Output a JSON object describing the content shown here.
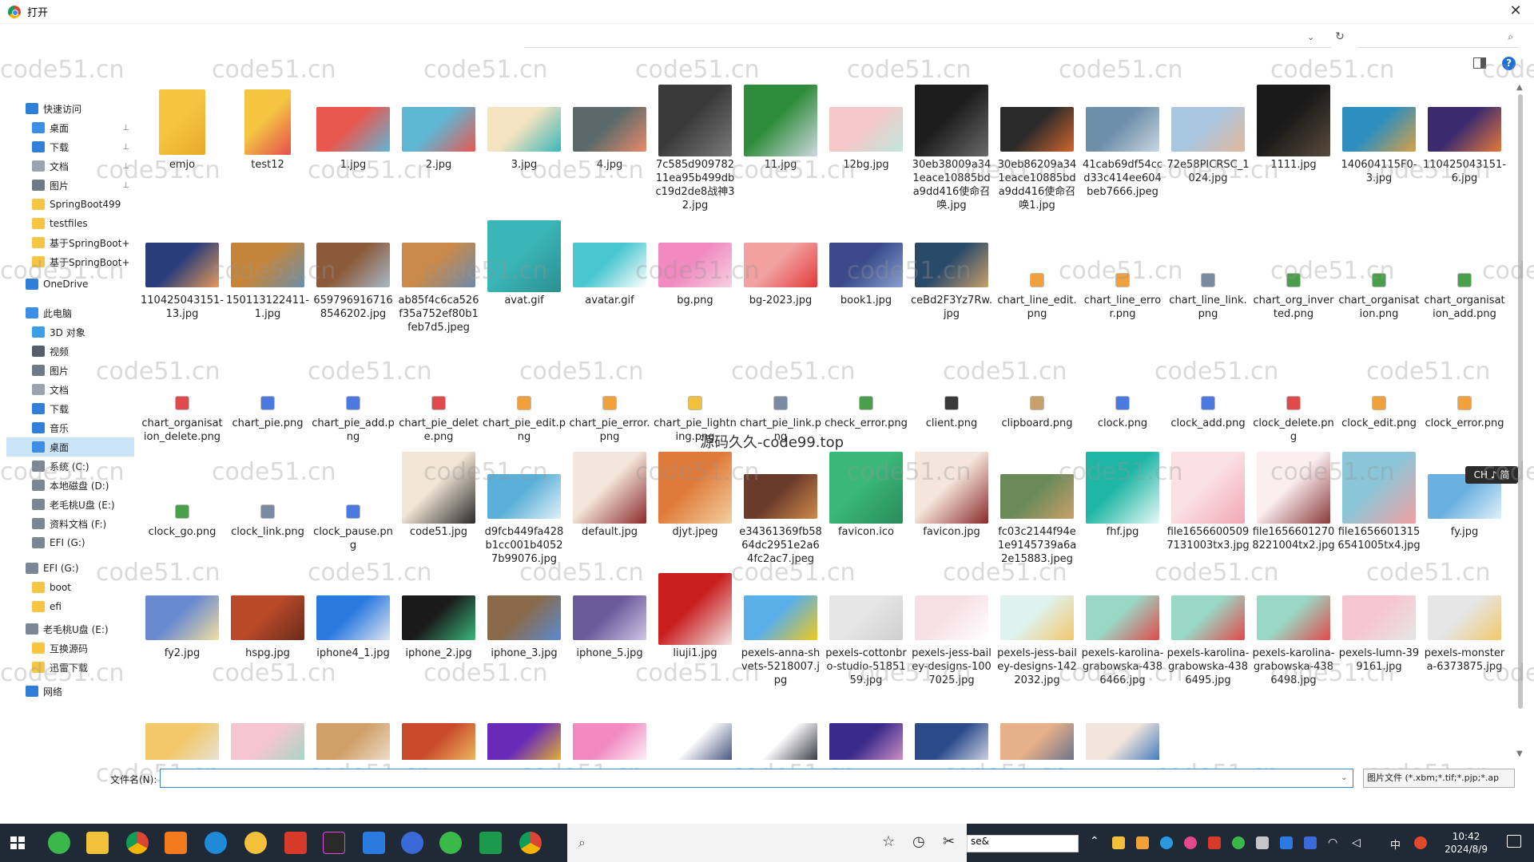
{
  "window": {
    "title": "打开"
  },
  "search": {
    "placeholder": ""
  },
  "sidebar": {
    "items": [
      {
        "label": "快速访问",
        "icon": "star-icon",
        "color": "#2f7fd8",
        "pin": false
      },
      {
        "label": "桌面",
        "icon": "desktop-icon",
        "color": "#3a8ee6",
        "pin": true
      },
      {
        "label": "下载",
        "icon": "download-icon",
        "color": "#2f7fd8",
        "pin": true
      },
      {
        "label": "文档",
        "icon": "document-icon",
        "color": "#9aa4b0",
        "pin": true
      },
      {
        "label": "图片",
        "icon": "pictures-icon",
        "color": "#6c7a89",
        "pin": true
      },
      {
        "label": "SpringBoot499",
        "icon": "folder-icon",
        "color": "#f5c542",
        "pin": false
      },
      {
        "label": "testfiles",
        "icon": "folder-icon",
        "color": "#f5c542",
        "pin": false
      },
      {
        "label": "基于SpringBoot+",
        "icon": "folder-icon",
        "color": "#f5c542",
        "pin": false
      },
      {
        "label": "基于SpringBoot+",
        "icon": "folder-icon",
        "color": "#f5c542",
        "pin": false
      },
      {
        "label": "OneDrive",
        "icon": "cloud-icon",
        "color": "#2f7fd8",
        "pin": false
      },
      {
        "label": "此电脑",
        "icon": "computer-icon",
        "color": "#3a8ee6",
        "pin": false
      },
      {
        "label": "3D 对象",
        "icon": "cube-icon",
        "color": "#3aa0e6",
        "pin": false
      },
      {
        "label": "视频",
        "icon": "video-icon",
        "color": "#555e6a",
        "pin": false
      },
      {
        "label": "图片",
        "icon": "pictures-icon",
        "color": "#6c7a89",
        "pin": false
      },
      {
        "label": "文档",
        "icon": "document-icon",
        "color": "#9aa4b0",
        "pin": false
      },
      {
        "label": "下载",
        "icon": "download-icon",
        "color": "#2f7fd8",
        "pin": false
      },
      {
        "label": "音乐",
        "icon": "music-icon",
        "color": "#2f7fd8",
        "pin": false
      },
      {
        "label": "桌面",
        "icon": "desktop-icon",
        "color": "#3a8ee6",
        "pin": false,
        "selected": true
      },
      {
        "label": "系统 (C:)",
        "icon": "drive-icon",
        "color": "#7a8796",
        "pin": false
      },
      {
        "label": "本地磁盘 (D:)",
        "icon": "drive-icon",
        "color": "#7a8796",
        "pin": false
      },
      {
        "label": "老毛桃U盘 (E:)",
        "icon": "drive-icon",
        "color": "#7a8796",
        "pin": false
      },
      {
        "label": "资料文档 (F:)",
        "icon": "drive-icon",
        "color": "#7a8796",
        "pin": false
      },
      {
        "label": "EFI (G:)",
        "icon": "drive-icon",
        "color": "#7a8796",
        "pin": false
      },
      {
        "label": "EFI (G:)",
        "icon": "drive-icon",
        "color": "#7a8796",
        "pin": false
      },
      {
        "label": "boot",
        "icon": "folder-icon",
        "color": "#f5c542",
        "pin": false
      },
      {
        "label": "efi",
        "icon": "folder-icon",
        "color": "#f5c542",
        "pin": false
      },
      {
        "label": "老毛桃U盘 (E:)",
        "icon": "drive-icon",
        "color": "#7a8796",
        "pin": false
      },
      {
        "label": "互换源码",
        "icon": "folder-icon",
        "color": "#f5c542",
        "pin": false
      },
      {
        "label": "迅雷下载",
        "icon": "folder-icon",
        "color": "#f5c542",
        "pin": false
      },
      {
        "label": "网络",
        "icon": "network-icon",
        "color": "#2f7fd8",
        "pin": false
      }
    ]
  },
  "files": [
    {
      "name": "emjo",
      "kind": "folder",
      "colors": [
        "#f5c542",
        "#e9a82a"
      ]
    },
    {
      "name": "test12",
      "kind": "folder",
      "colors": [
        "#f5c542",
        "#e44d4d"
      ]
    },
    {
      "name": "1.jpg",
      "kind": "image",
      "colors": [
        "#e8584f",
        "#5fb7d6"
      ]
    },
    {
      "name": "2.jpg",
      "kind": "image",
      "colors": [
        "#5fb7d6",
        "#e8584f"
      ]
    },
    {
      "name": "3.jpg",
      "kind": "image",
      "colors": [
        "#f3e3c0",
        "#3bb6b8"
      ]
    },
    {
      "name": "4.jpg",
      "kind": "image",
      "colors": [
        "#5a6a6a",
        "#e88a6a"
      ]
    },
    {
      "name": "7c585d90978211eа95b499dbc19d2de8战神32.jpg",
      "kind": "image",
      "colors": [
        "#3a3a3a",
        "#7a7a7a"
      ]
    },
    {
      "name": "11.jpg",
      "kind": "image",
      "colors": [
        "#2e8b3a",
        "#cfd9e0"
      ]
    },
    {
      "name": "12bg.jpg",
      "kind": "image",
      "colors": [
        "#f6c7c7",
        "#bfe6dd"
      ]
    },
    {
      "name": "30eb38009a341eace10885bda9dd416使命召唤.jpg",
      "kind": "image",
      "colors": [
        "#1d1d1d",
        "#6a6a6a"
      ]
    },
    {
      "name": "30eb86209a341eace10885bda9dd416使命召唤1.jpg",
      "kind": "image",
      "colors": [
        "#2a2a2a",
        "#d2652d"
      ]
    },
    {
      "name": "41cab69df54ccd33c414ee604beb7666.jpeg",
      "kind": "image",
      "colors": [
        "#6e8faa",
        "#c8d6e0"
      ]
    },
    {
      "name": "72e58PICRSC_1024.jpg",
      "kind": "image",
      "colors": [
        "#a9c6e0",
        "#e3b89a"
      ]
    },
    {
      "name": "1111.jpg",
      "kind": "image",
      "colors": [
        "#1a1a1a",
        "#5a4a3a"
      ]
    },
    {
      "name": "140604115F0-3.jpg",
      "kind": "image",
      "colors": [
        "#2d8fbf",
        "#d9a043"
      ]
    },
    {
      "name": "110425043151-6.jpg",
      "kind": "image",
      "colors": [
        "#3c2a6e",
        "#e57a3a"
      ]
    },
    {
      "name": "110425043151-13.jpg",
      "kind": "image",
      "colors": [
        "#2a3c7a",
        "#e59a5a"
      ]
    },
    {
      "name": "150113122411-1.jpg",
      "kind": "image",
      "colors": [
        "#c4853a",
        "#6a8faa"
      ]
    },
    {
      "name": "6597969167168546202.jpg",
      "kind": "image",
      "colors": [
        "#8a5a3a",
        "#a9b8c6"
      ]
    },
    {
      "name": "ab85f4c6ca526f35a752ef80b1feb7d5.jpeg",
      "kind": "image",
      "colors": [
        "#c98a4a",
        "#6e8aa9"
      ]
    },
    {
      "name": "avat.gif",
      "kind": "image",
      "colors": [
        "#3bb6b8",
        "#2b8f91"
      ]
    },
    {
      "name": "avatar.gif",
      "kind": "image",
      "colors": [
        "#49c7d0",
        "#ffffff"
      ]
    },
    {
      "name": "bg.png",
      "kind": "image",
      "colors": [
        "#f08ac0",
        "#f5d0e0"
      ]
    },
    {
      "name": "bg-2023.jpg",
      "kind": "image",
      "colors": [
        "#f2a0a0",
        "#e23a3a"
      ]
    },
    {
      "name": "book1.jpg",
      "kind": "image",
      "colors": [
        "#3a4a8a",
        "#8aa0d0"
      ]
    },
    {
      "name": "ceBd2F3Yz7Rw.jpg",
      "kind": "image",
      "colors": [
        "#2a4a6a",
        "#c9a06a"
      ]
    },
    {
      "name": "chart_line_edit.png",
      "kind": "icon",
      "colors": [
        "#f2a03a"
      ]
    },
    {
      "name": "chart_line_error.png",
      "kind": "icon",
      "colors": [
        "#f2a03a"
      ]
    },
    {
      "name": "chart_line_link.png",
      "kind": "icon",
      "colors": [
        "#7a8aa0"
      ]
    },
    {
      "name": "chart_org_inverted.png",
      "kind": "icon",
      "colors": [
        "#4aa04a"
      ]
    },
    {
      "name": "chart_organisation.png",
      "kind": "icon",
      "colors": [
        "#4aa04a"
      ]
    },
    {
      "name": "chart_organisation_add.png",
      "kind": "icon",
      "colors": [
        "#4aa04a"
      ]
    },
    {
      "name": "chart_organisation_delete.png",
      "kind": "icon",
      "colors": [
        "#e04a4a"
      ]
    },
    {
      "name": "chart_pie.png",
      "kind": "icon",
      "colors": [
        "#4a7ae0"
      ]
    },
    {
      "name": "chart_pie_add.png",
      "kind": "icon",
      "colors": [
        "#4a7ae0"
      ]
    },
    {
      "name": "chart_pie_delete.png",
      "kind": "icon",
      "colors": [
        "#e04a4a"
      ]
    },
    {
      "name": "chart_pie_edit.png",
      "kind": "icon",
      "colors": [
        "#f2a03a"
      ]
    },
    {
      "name": "chart_pie_error.png",
      "kind": "icon",
      "colors": [
        "#f2a03a"
      ]
    },
    {
      "name": "chart_pie_lightning.png",
      "kind": "icon",
      "colors": [
        "#f2c03a"
      ]
    },
    {
      "name": "chart_pie_link.png",
      "kind": "icon",
      "colors": [
        "#7a8aa0"
      ]
    },
    {
      "name": "check_error.png",
      "kind": "icon",
      "colors": [
        "#4aa04a"
      ]
    },
    {
      "name": "client.png",
      "kind": "icon",
      "colors": [
        "#3a3a3a"
      ]
    },
    {
      "name": "clipboard.png",
      "kind": "icon",
      "colors": [
        "#c9a06a"
      ]
    },
    {
      "name": "clock.png",
      "kind": "icon",
      "colors": [
        "#4a7ae0"
      ]
    },
    {
      "name": "clock_add.png",
      "kind": "icon",
      "colors": [
        "#4a7ae0"
      ]
    },
    {
      "name": "clock_delete.png",
      "kind": "icon",
      "colors": [
        "#e04a4a"
      ]
    },
    {
      "name": "clock_edit.png",
      "kind": "icon",
      "colors": [
        "#f2a03a"
      ]
    },
    {
      "name": "clock_error.png",
      "kind": "icon",
      "colors": [
        "#f2a03a"
      ]
    },
    {
      "name": "clock_go.png",
      "kind": "icon",
      "colors": [
        "#4aa04a"
      ]
    },
    {
      "name": "clock_link.png",
      "kind": "icon",
      "colors": [
        "#7a8aa0"
      ]
    },
    {
      "name": "clock_pause.png",
      "kind": "icon",
      "colors": [
        "#4a7ae0"
      ]
    },
    {
      "name": "code51.jpg",
      "kind": "image",
      "colors": [
        "#f2e6d6",
        "#2a2a2a"
      ]
    },
    {
      "name": "d9fcb449fa428b1cc001b40527b99076.jpg",
      "kind": "image",
      "colors": [
        "#5ab0d8",
        "#e0f0f8"
      ]
    },
    {
      "name": "default.jpg",
      "kind": "image",
      "colors": [
        "#f5e6dc",
        "#8a2a2a"
      ]
    },
    {
      "name": "djyt.jpeg",
      "kind": "image",
      "colors": [
        "#e07a3a",
        "#f2d0a0"
      ]
    },
    {
      "name": "e34361369fb5864dc2951e2a64fc2ac7.jpeg",
      "kind": "image",
      "colors": [
        "#6a3a2a",
        "#d08a4a"
      ]
    },
    {
      "name": "favicon.ico",
      "kind": "image",
      "colors": [
        "#3ab87a",
        "#2a8a5a"
      ]
    },
    {
      "name": "favicon.jpg",
      "kind": "image",
      "colors": [
        "#f5e6dc",
        "#8a2a2a"
      ]
    },
    {
      "name": "fc03c2144f94e1e9145739a6a2e15883.jpeg",
      "kind": "image",
      "colors": [
        "#6a8a5a",
        "#c9a06a"
      ]
    },
    {
      "name": "fhf.jpg",
      "kind": "image",
      "colors": [
        "#1fb6a6",
        "#e8f8f6"
      ]
    },
    {
      "name": "file16566005097131003tx3.jpg",
      "kind": "image",
      "colors": [
        "#fbe0e4",
        "#f2a8b4"
      ]
    },
    {
      "name": "file16566012708221004tx2.jpg",
      "kind": "image",
      "colors": [
        "#fbeef0",
        "#8a3a3a"
      ]
    },
    {
      "name": "file16566013156541005tx4.jpg",
      "kind": "image",
      "colors": [
        "#8ac6d8",
        "#f2a0a0"
      ]
    },
    {
      "name": "fy.jpg",
      "kind": "image",
      "colors": [
        "#6ab0e0",
        "#e0f0fa"
      ]
    },
    {
      "name": "fy2.jpg",
      "kind": "image",
      "colors": [
        "#6a8ad0",
        "#f2e0a0"
      ]
    },
    {
      "name": "hspg.jpg",
      "kind": "image",
      "colors": [
        "#b84a2a",
        "#6a2a1a"
      ]
    },
    {
      "name": "iphone4_1.jpg",
      "kind": "image",
      "colors": [
        "#2a7ae0",
        "#e0e6f0"
      ]
    },
    {
      "name": "iphone_2.jpg",
      "kind": "image",
      "colors": [
        "#1a1a1a",
        "#3ab87a"
      ]
    },
    {
      "name": "iphone_3.jpg",
      "kind": "image",
      "colors": [
        "#8a6a4a",
        "#5a8ad0"
      ]
    },
    {
      "name": "iphone_5.jpg",
      "kind": "image",
      "colors": [
        "#6a5a9a",
        "#d0c6e8"
      ]
    },
    {
      "name": "liuji1.jpg",
      "kind": "image",
      "colors": [
        "#c81e1e",
        "#f2e6e6"
      ]
    },
    {
      "name": "pexels-anna-shvets-5218007.jpg",
      "kind": "image",
      "colors": [
        "#5ab0e8",
        "#f2c81e"
      ]
    },
    {
      "name": "pexels-cottonbro-studio-5185159.jpg",
      "kind": "image",
      "colors": [
        "#e6e6e6",
        "#cfcfcf"
      ]
    },
    {
      "name": "pexels-jess-bailey-designs-1007025.jpg",
      "kind": "image",
      "colors": [
        "#f6e0e6",
        "#ffffff"
      ]
    },
    {
      "name": "pexels-jess-bailey-designs-1422032.jpg",
      "kind": "image",
      "colors": [
        "#e0f2ee",
        "#f2c86a"
      ]
    },
    {
      "name": "pexels-karolina-grabowska-4386466.jpg",
      "kind": "image",
      "colors": [
        "#9ad8c6",
        "#e04a4a"
      ]
    },
    {
      "name": "pexels-karolina-grabowska-4386495.jpg",
      "kind": "image",
      "colors": [
        "#9ad8c6",
        "#e04a4a"
      ]
    },
    {
      "name": "pexels-karolina-grabowska-4386498.jpg",
      "kind": "image",
      "colors": [
        "#9ad8c6",
        "#e04a4a"
      ]
    },
    {
      "name": "pexels-lumn-399161.jpg",
      "kind": "image",
      "colors": [
        "#f6c6d0",
        "#e6e6e6"
      ]
    },
    {
      "name": "pexels-monstera-6373875.jpg",
      "kind": "image",
      "colors": [
        "#e6e6e6",
        "#f2c86a"
      ]
    },
    {
      "name": "",
      "kind": "partial",
      "colors": [
        "#f2c86a",
        "#e6e6e6"
      ]
    },
    {
      "name": "",
      "kind": "partial",
      "colors": [
        "#f6c6d0",
        "#9ad8c6"
      ]
    },
    {
      "name": "",
      "kind": "partial",
      "colors": [
        "#d0a06a",
        "#f2e6d6"
      ]
    },
    {
      "name": "",
      "kind": "partial",
      "colors": [
        "#c84a2a",
        "#f2c86a"
      ]
    },
    {
      "name": "",
      "kind": "partial",
      "colors": [
        "#6a2ab8",
        "#f2c81e"
      ]
    },
    {
      "name": "",
      "kind": "partial",
      "colors": [
        "#f08ac0",
        "#ffffff"
      ]
    },
    {
      "name": "",
      "kind": "partial",
      "colors": [
        "#ffffff",
        "#2a3a6a"
      ]
    },
    {
      "name": "",
      "kind": "partial",
      "colors": [
        "#ffffff",
        "#1a1a2a"
      ]
    },
    {
      "name": "",
      "kind": "partial",
      "colors": [
        "#3a2a8a",
        "#e6a0d0"
      ]
    },
    {
      "name": "",
      "kind": "partial",
      "colors": [
        "#2a4a8a",
        "#e6e6f0"
      ]
    },
    {
      "name": "",
      "kind": "partial",
      "colors": [
        "#e6b08a",
        "#5a6a8a"
      ]
    },
    {
      "name": "",
      "kind": "partial",
      "colors": [
        "#f2e6dc",
        "#2a6ab8"
      ]
    }
  ],
  "overlay": {
    "text": "源码久久-code99.top"
  },
  "ime": {
    "label": "CH ♪ 简"
  },
  "watermark": "code51.cn",
  "filename": {
    "label": "文件名(N):",
    "value": ""
  },
  "filetype": {
    "value": "图片文件 (*.xbm;*.tif;*.pjp;*.ap"
  },
  "taskbar": {
    "search_value": "se&",
    "time": "10:42",
    "date": "2024/8/9",
    "tray_lang": "中"
  }
}
